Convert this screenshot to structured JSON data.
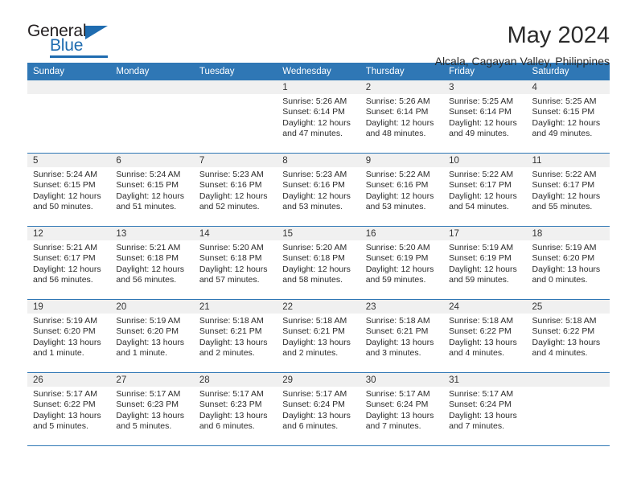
{
  "brand": {
    "word_one": "General",
    "word_two": "Blue",
    "triangle_icon": "triangle-icon"
  },
  "header": {
    "title": "May 2024",
    "location": "Alcala, Cagayan Valley, Philippines"
  },
  "colors": {
    "header_blue": "#2f77b5",
    "brand_blue": "#1f6cb0",
    "daynum_band": "#f0f0f0",
    "text": "#2b2b2b"
  },
  "weekday_headers": [
    "Sunday",
    "Monday",
    "Tuesday",
    "Wednesday",
    "Thursday",
    "Friday",
    "Saturday"
  ],
  "labels": {
    "sunrise_prefix": "Sunrise:",
    "sunset_prefix": "Sunset:",
    "daylight_prefix": "Daylight:"
  },
  "weeks": [
    [
      {
        "day": "",
        "sunrise": "",
        "sunset": "",
        "daylight_line1": "",
        "daylight_line2": ""
      },
      {
        "day": "",
        "sunrise": "",
        "sunset": "",
        "daylight_line1": "",
        "daylight_line2": ""
      },
      {
        "day": "",
        "sunrise": "",
        "sunset": "",
        "daylight_line1": "",
        "daylight_line2": ""
      },
      {
        "day": "1",
        "sunrise": "Sunrise: 5:26 AM",
        "sunset": "Sunset: 6:14 PM",
        "daylight_line1": "Daylight: 12 hours",
        "daylight_line2": "and 47 minutes."
      },
      {
        "day": "2",
        "sunrise": "Sunrise: 5:26 AM",
        "sunset": "Sunset: 6:14 PM",
        "daylight_line1": "Daylight: 12 hours",
        "daylight_line2": "and 48 minutes."
      },
      {
        "day": "3",
        "sunrise": "Sunrise: 5:25 AM",
        "sunset": "Sunset: 6:14 PM",
        "daylight_line1": "Daylight: 12 hours",
        "daylight_line2": "and 49 minutes."
      },
      {
        "day": "4",
        "sunrise": "Sunrise: 5:25 AM",
        "sunset": "Sunset: 6:15 PM",
        "daylight_line1": "Daylight: 12 hours",
        "daylight_line2": "and 49 minutes."
      }
    ],
    [
      {
        "day": "5",
        "sunrise": "Sunrise: 5:24 AM",
        "sunset": "Sunset: 6:15 PM",
        "daylight_line1": "Daylight: 12 hours",
        "daylight_line2": "and 50 minutes."
      },
      {
        "day": "6",
        "sunrise": "Sunrise: 5:24 AM",
        "sunset": "Sunset: 6:15 PM",
        "daylight_line1": "Daylight: 12 hours",
        "daylight_line2": "and 51 minutes."
      },
      {
        "day": "7",
        "sunrise": "Sunrise: 5:23 AM",
        "sunset": "Sunset: 6:16 PM",
        "daylight_line1": "Daylight: 12 hours",
        "daylight_line2": "and 52 minutes."
      },
      {
        "day": "8",
        "sunrise": "Sunrise: 5:23 AM",
        "sunset": "Sunset: 6:16 PM",
        "daylight_line1": "Daylight: 12 hours",
        "daylight_line2": "and 53 minutes."
      },
      {
        "day": "9",
        "sunrise": "Sunrise: 5:22 AM",
        "sunset": "Sunset: 6:16 PM",
        "daylight_line1": "Daylight: 12 hours",
        "daylight_line2": "and 53 minutes."
      },
      {
        "day": "10",
        "sunrise": "Sunrise: 5:22 AM",
        "sunset": "Sunset: 6:17 PM",
        "daylight_line1": "Daylight: 12 hours",
        "daylight_line2": "and 54 minutes."
      },
      {
        "day": "11",
        "sunrise": "Sunrise: 5:22 AM",
        "sunset": "Sunset: 6:17 PM",
        "daylight_line1": "Daylight: 12 hours",
        "daylight_line2": "and 55 minutes."
      }
    ],
    [
      {
        "day": "12",
        "sunrise": "Sunrise: 5:21 AM",
        "sunset": "Sunset: 6:17 PM",
        "daylight_line1": "Daylight: 12 hours",
        "daylight_line2": "and 56 minutes."
      },
      {
        "day": "13",
        "sunrise": "Sunrise: 5:21 AM",
        "sunset": "Sunset: 6:18 PM",
        "daylight_line1": "Daylight: 12 hours",
        "daylight_line2": "and 56 minutes."
      },
      {
        "day": "14",
        "sunrise": "Sunrise: 5:20 AM",
        "sunset": "Sunset: 6:18 PM",
        "daylight_line1": "Daylight: 12 hours",
        "daylight_line2": "and 57 minutes."
      },
      {
        "day": "15",
        "sunrise": "Sunrise: 5:20 AM",
        "sunset": "Sunset: 6:18 PM",
        "daylight_line1": "Daylight: 12 hours",
        "daylight_line2": "and 58 minutes."
      },
      {
        "day": "16",
        "sunrise": "Sunrise: 5:20 AM",
        "sunset": "Sunset: 6:19 PM",
        "daylight_line1": "Daylight: 12 hours",
        "daylight_line2": "and 59 minutes."
      },
      {
        "day": "17",
        "sunrise": "Sunrise: 5:19 AM",
        "sunset": "Sunset: 6:19 PM",
        "daylight_line1": "Daylight: 12 hours",
        "daylight_line2": "and 59 minutes."
      },
      {
        "day": "18",
        "sunrise": "Sunrise: 5:19 AM",
        "sunset": "Sunset: 6:20 PM",
        "daylight_line1": "Daylight: 13 hours",
        "daylight_line2": "and 0 minutes."
      }
    ],
    [
      {
        "day": "19",
        "sunrise": "Sunrise: 5:19 AM",
        "sunset": "Sunset: 6:20 PM",
        "daylight_line1": "Daylight: 13 hours",
        "daylight_line2": "and 1 minute."
      },
      {
        "day": "20",
        "sunrise": "Sunrise: 5:19 AM",
        "sunset": "Sunset: 6:20 PM",
        "daylight_line1": "Daylight: 13 hours",
        "daylight_line2": "and 1 minute."
      },
      {
        "day": "21",
        "sunrise": "Sunrise: 5:18 AM",
        "sunset": "Sunset: 6:21 PM",
        "daylight_line1": "Daylight: 13 hours",
        "daylight_line2": "and 2 minutes."
      },
      {
        "day": "22",
        "sunrise": "Sunrise: 5:18 AM",
        "sunset": "Sunset: 6:21 PM",
        "daylight_line1": "Daylight: 13 hours",
        "daylight_line2": "and 2 minutes."
      },
      {
        "day": "23",
        "sunrise": "Sunrise: 5:18 AM",
        "sunset": "Sunset: 6:21 PM",
        "daylight_line1": "Daylight: 13 hours",
        "daylight_line2": "and 3 minutes."
      },
      {
        "day": "24",
        "sunrise": "Sunrise: 5:18 AM",
        "sunset": "Sunset: 6:22 PM",
        "daylight_line1": "Daylight: 13 hours",
        "daylight_line2": "and 4 minutes."
      },
      {
        "day": "25",
        "sunrise": "Sunrise: 5:18 AM",
        "sunset": "Sunset: 6:22 PM",
        "daylight_line1": "Daylight: 13 hours",
        "daylight_line2": "and 4 minutes."
      }
    ],
    [
      {
        "day": "26",
        "sunrise": "Sunrise: 5:17 AM",
        "sunset": "Sunset: 6:22 PM",
        "daylight_line1": "Daylight: 13 hours",
        "daylight_line2": "and 5 minutes."
      },
      {
        "day": "27",
        "sunrise": "Sunrise: 5:17 AM",
        "sunset": "Sunset: 6:23 PM",
        "daylight_line1": "Daylight: 13 hours",
        "daylight_line2": "and 5 minutes."
      },
      {
        "day": "28",
        "sunrise": "Sunrise: 5:17 AM",
        "sunset": "Sunset: 6:23 PM",
        "daylight_line1": "Daylight: 13 hours",
        "daylight_line2": "and 6 minutes."
      },
      {
        "day": "29",
        "sunrise": "Sunrise: 5:17 AM",
        "sunset": "Sunset: 6:24 PM",
        "daylight_line1": "Daylight: 13 hours",
        "daylight_line2": "and 6 minutes."
      },
      {
        "day": "30",
        "sunrise": "Sunrise: 5:17 AM",
        "sunset": "Sunset: 6:24 PM",
        "daylight_line1": "Daylight: 13 hours",
        "daylight_line2": "and 7 minutes."
      },
      {
        "day": "31",
        "sunrise": "Sunrise: 5:17 AM",
        "sunset": "Sunset: 6:24 PM",
        "daylight_line1": "Daylight: 13 hours",
        "daylight_line2": "and 7 minutes."
      },
      {
        "day": "",
        "sunrise": "",
        "sunset": "",
        "daylight_line1": "",
        "daylight_line2": ""
      }
    ]
  ]
}
